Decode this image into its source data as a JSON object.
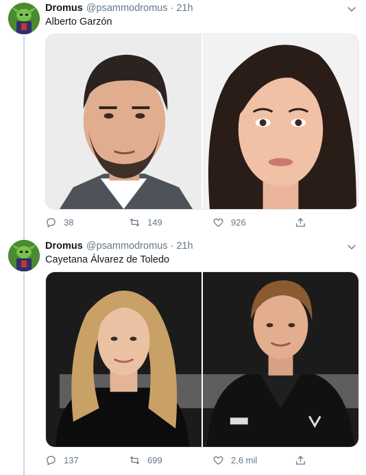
{
  "tweets": [
    {
      "author_name": "Dromus",
      "author_handle": "@psammodromus",
      "separator": "·",
      "time": "21h",
      "text": "Alberto Garzón",
      "photos": [
        {
          "kind": "man-dark-hair-beard",
          "bg": "#ececec"
        },
        {
          "kind": "woman-dark-hair",
          "bg": "#f2f2f2"
        }
      ],
      "replies": "38",
      "retweets": "149",
      "likes": "926"
    },
    {
      "author_name": "Dromus",
      "author_handle": "@psammodromus",
      "separator": "·",
      "time": "21h",
      "text": "Cayetana Álvarez de Toledo",
      "photos": [
        {
          "kind": "woman-blonde-hair",
          "bg": "#1b1b1b"
        },
        {
          "kind": "man-short-hair-black-shirt",
          "bg": "#1b1b1b"
        }
      ],
      "replies": "137",
      "retweets": "699",
      "likes": "2,6 mil"
    }
  ],
  "icons": {
    "reply": "reply-icon",
    "retweet": "retweet-icon",
    "like": "heart-icon",
    "share": "share-icon",
    "more": "chevron-down-icon"
  },
  "colors": {
    "text": "#14171a",
    "secondary": "#657786",
    "thread_line": "#ccd6dd",
    "avatar_bg": "#3c7a2e"
  }
}
